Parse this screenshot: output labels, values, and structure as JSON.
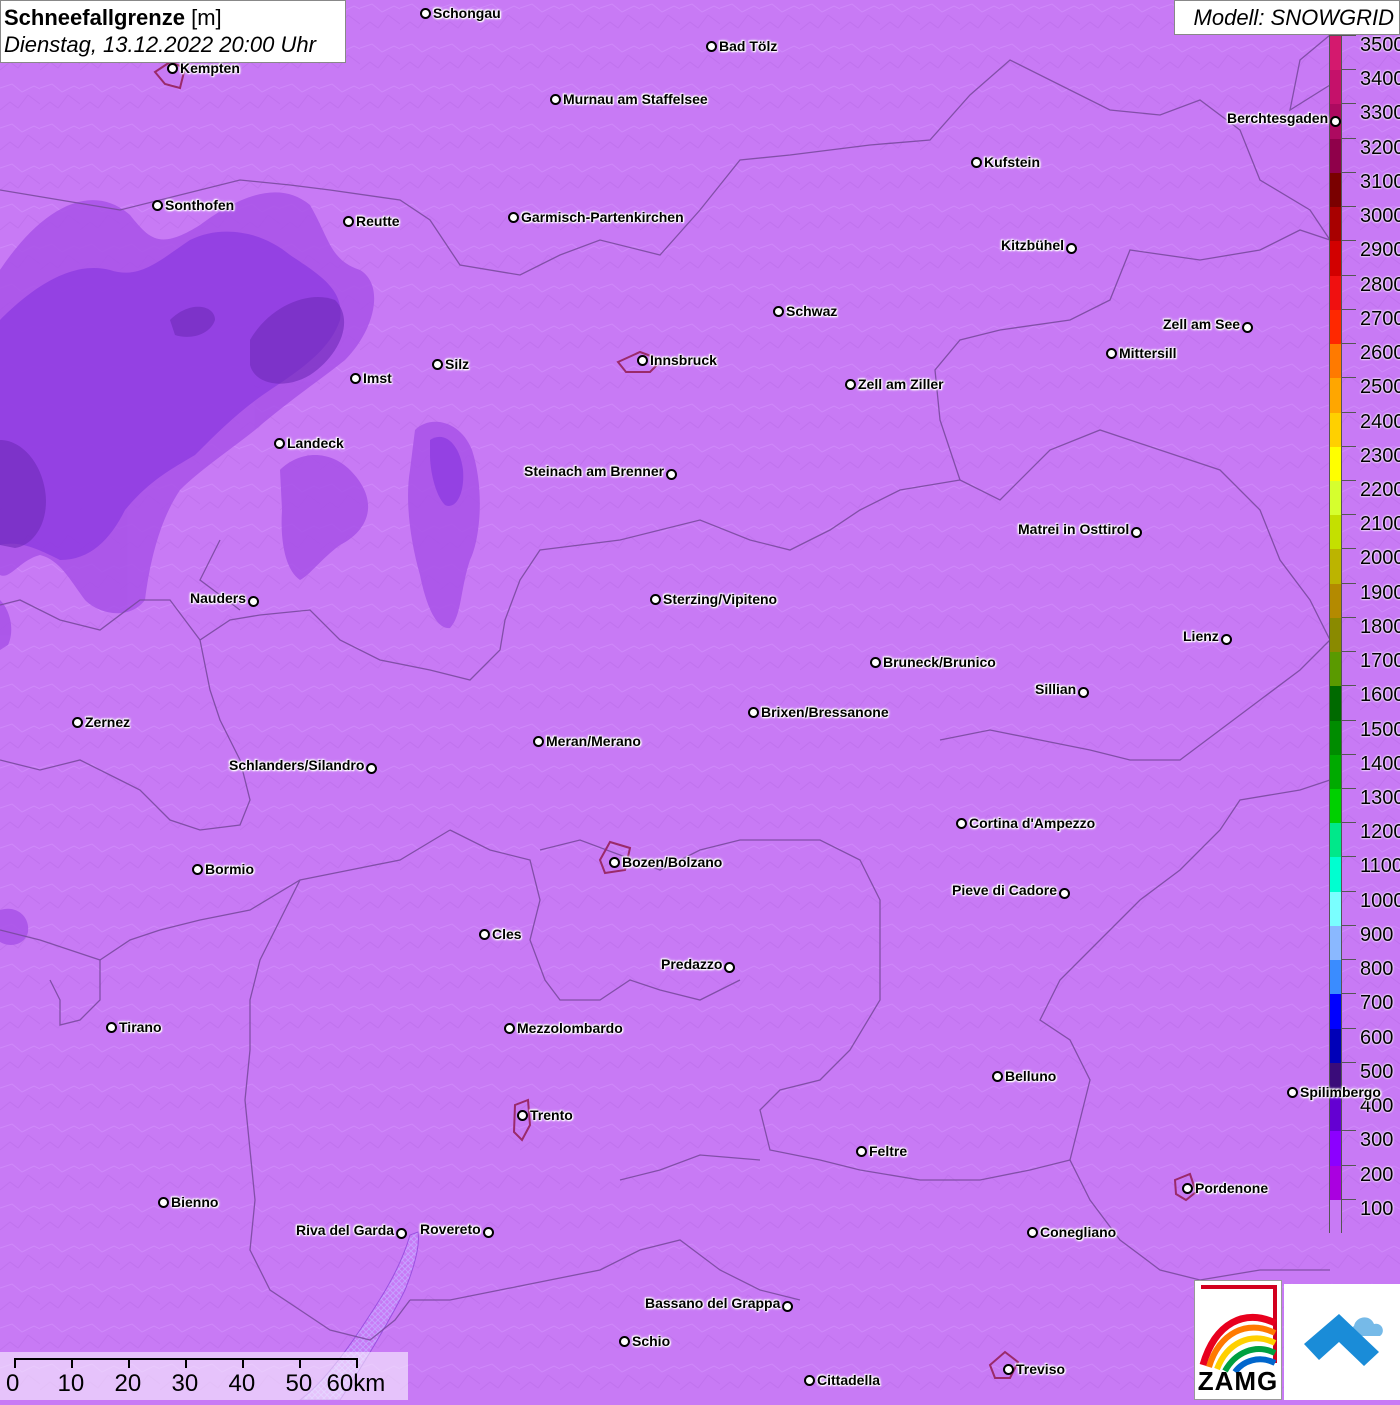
{
  "title": {
    "label": "Schneefallgrenze",
    "unit": "[m]",
    "datetime": "Dienstag, 13.12.2022 20:00 Uhr"
  },
  "model": "Modell: SNOWGRID",
  "legend": {
    "entries": [
      {
        "value": "3500",
        "color": "#d4196e"
      },
      {
        "value": "3400",
        "color": "#c5116a"
      },
      {
        "value": "3300",
        "color": "#ad0a60"
      },
      {
        "value": "3200",
        "color": "#8f004a"
      },
      {
        "value": "3100",
        "color": "#7a0000"
      },
      {
        "value": "3000",
        "color": "#a80000"
      },
      {
        "value": "2900",
        "color": "#d20000"
      },
      {
        "value": "2800",
        "color": "#f01010"
      },
      {
        "value": "2700",
        "color": "#ff2800"
      },
      {
        "value": "2600",
        "color": "#ff7a00"
      },
      {
        "value": "2500",
        "color": "#ffa600"
      },
      {
        "value": "2400",
        "color": "#ffd000"
      },
      {
        "value": "2300",
        "color": "#ffff00"
      },
      {
        "value": "2200",
        "color": "#d6ff2e"
      },
      {
        "value": "2100",
        "color": "#c4e000"
      },
      {
        "value": "2000",
        "color": "#bcb400"
      },
      {
        "value": "1900",
        "color": "#b48a00"
      },
      {
        "value": "1800",
        "color": "#8a8a00"
      },
      {
        "value": "1700",
        "color": "#5a9a00"
      },
      {
        "value": "1600",
        "color": "#006a00"
      },
      {
        "value": "1500",
        "color": "#008c00"
      },
      {
        "value": "1400",
        "color": "#00aa00"
      },
      {
        "value": "1300",
        "color": "#00d000"
      },
      {
        "value": "1200",
        "color": "#00e88a"
      },
      {
        "value": "1100",
        "color": "#00ffd0"
      },
      {
        "value": "1000",
        "color": "#7affff"
      },
      {
        "value": "900",
        "color": "#8ab8ff"
      },
      {
        "value": "800",
        "color": "#3a8cff"
      },
      {
        "value": "700",
        "color": "#0000ff"
      },
      {
        "value": "600",
        "color": "#0000b8"
      },
      {
        "value": "500",
        "color": "#3a0c7a"
      },
      {
        "value": "400",
        "color": "#6400d2"
      },
      {
        "value": "300",
        "color": "#8c00ff"
      },
      {
        "value": "200",
        "color": "#aa00e0"
      },
      {
        "value": "100",
        "color": "#c87af5"
      }
    ]
  },
  "cities": [
    {
      "name": "Schongau",
      "side": "right"
    },
    {
      "name": "Bad Tölz",
      "side": "right"
    },
    {
      "name": "Kempten",
      "side": "right"
    },
    {
      "name": "Murnau am Staffelsee",
      "side": "right"
    },
    {
      "name": "Berchtesgaden",
      "side": "left"
    },
    {
      "name": "Kufstein",
      "side": "right"
    },
    {
      "name": "Sonthofen",
      "side": "right"
    },
    {
      "name": "Reutte",
      "side": "right"
    },
    {
      "name": "Garmisch-Partenkirchen",
      "side": "right"
    },
    {
      "name": "Kitzbühel",
      "side": "left"
    },
    {
      "name": "Schwaz",
      "side": "right"
    },
    {
      "name": "Zell am See",
      "side": "left"
    },
    {
      "name": "Innsbruck",
      "side": "right"
    },
    {
      "name": "Mittersill",
      "side": "right"
    },
    {
      "name": "Imst",
      "side": "right"
    },
    {
      "name": "Silz",
      "side": "right"
    },
    {
      "name": "Zell am Ziller",
      "side": "right"
    },
    {
      "name": "Landeck",
      "side": "right"
    },
    {
      "name": "Steinach am Brenner",
      "side": "left"
    },
    {
      "name": "Matrei in Osttirol",
      "side": "left"
    },
    {
      "name": "Nauders",
      "side": "left"
    },
    {
      "name": "Sterzing/Vipiteno",
      "side": "right"
    },
    {
      "name": "Lienz",
      "side": "left"
    },
    {
      "name": "Bruneck/Brunico",
      "side": "right"
    },
    {
      "name": "Sillian",
      "side": "left"
    },
    {
      "name": "Zernez",
      "side": "right"
    },
    {
      "name": "Brixen/Bressanone",
      "side": "right"
    },
    {
      "name": "Meran/Merano",
      "side": "right"
    },
    {
      "name": "Schlanders/Silandro",
      "side": "left"
    },
    {
      "name": "Cortina d'Ampezzo",
      "side": "right"
    },
    {
      "name": "Bozen/Bolzano",
      "side": "right"
    },
    {
      "name": "Bormio",
      "side": "right"
    },
    {
      "name": "Pieve di Cadore",
      "side": "left"
    },
    {
      "name": "Cles",
      "side": "right"
    },
    {
      "name": "Predazzo",
      "side": "left"
    },
    {
      "name": "Tirano",
      "side": "right"
    },
    {
      "name": "Mezzolombardo",
      "side": "right"
    },
    {
      "name": "Belluno",
      "side": "right"
    },
    {
      "name": "Spilimbergo",
      "side": "right"
    },
    {
      "name": "Trento",
      "side": "right"
    },
    {
      "name": "Feltre",
      "side": "right"
    },
    {
      "name": "Pordenone",
      "side": "right"
    },
    {
      "name": "Bienno",
      "side": "right"
    },
    {
      "name": "Riva del Garda",
      "side": "left"
    },
    {
      "name": "Rovereto",
      "side": "left"
    },
    {
      "name": "Conegliano",
      "side": "right"
    },
    {
      "name": "Bassano del Grappa",
      "side": "left"
    },
    {
      "name": "Schio",
      "side": "right"
    },
    {
      "name": "Treviso",
      "side": "right"
    },
    {
      "name": "Cittadella",
      "side": "right"
    }
  ],
  "scalebar": {
    "labels": [
      "0",
      "10",
      "20",
      "30",
      "40",
      "50",
      "60km"
    ]
  },
  "logo": {
    "zamg_text": "ZAMG"
  }
}
